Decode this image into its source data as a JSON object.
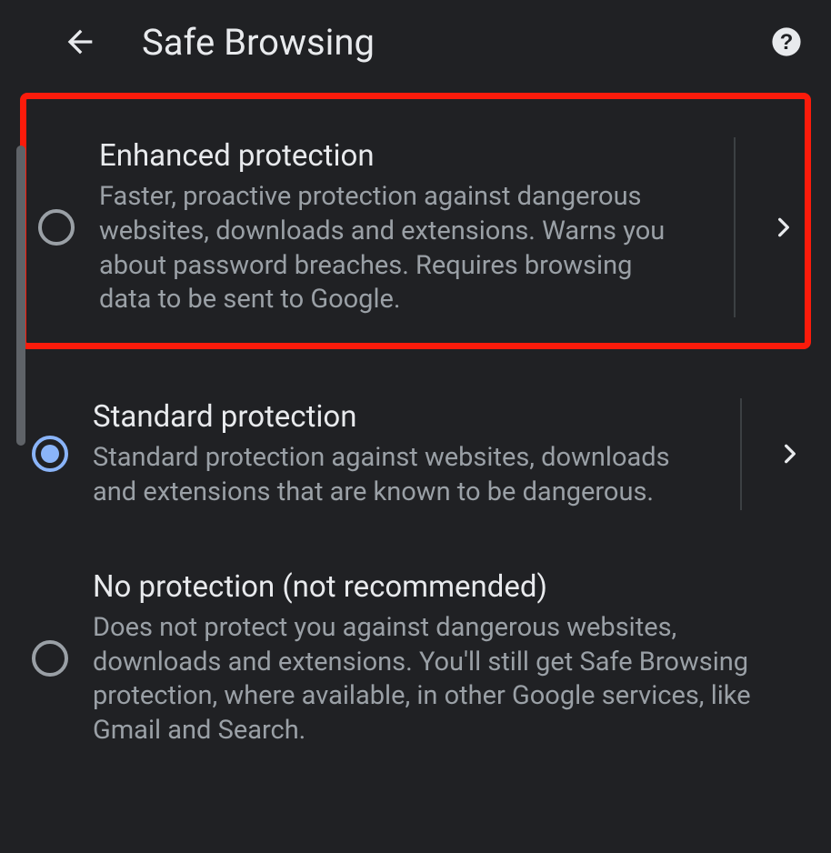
{
  "header": {
    "title": "Safe Browsing"
  },
  "options": [
    {
      "title": "Enhanced protection",
      "description": "Faster, proactive protection against dangerous websites, downloads and extensions. Warns you about password breaches. Requires browsing data to be sent to Google.",
      "selected": false,
      "highlighted": true,
      "hasDetail": true
    },
    {
      "title": "Standard protection",
      "description": "Standard protection against websites, downloads and extensions that are known to be dangerous.",
      "selected": true,
      "highlighted": false,
      "hasDetail": true
    },
    {
      "title": "No protection (not recommended)",
      "description": "Does not protect you against dangerous websites, downloads and extensions. You'll still get Safe Browsing protection, where available, in other Google services, like Gmail and Search.",
      "selected": false,
      "highlighted": false,
      "hasDetail": false
    }
  ]
}
